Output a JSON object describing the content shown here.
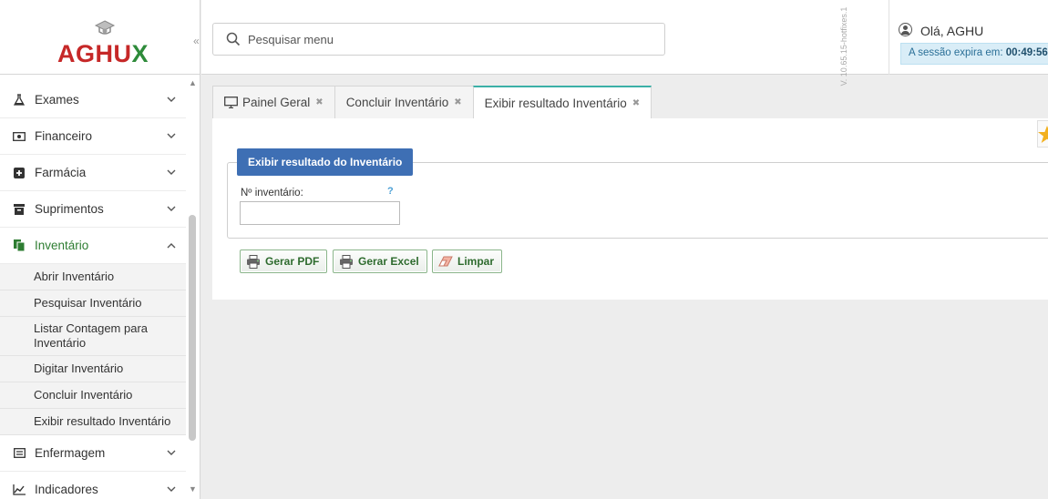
{
  "logo": {
    "text_main": "AGHU",
    "text_x": "X"
  },
  "sidebar": {
    "collapse_glyph": "«",
    "items": [
      {
        "label": "Exames",
        "icon": "flask-icon"
      },
      {
        "label": "Financeiro",
        "icon": "money-icon"
      },
      {
        "label": "Farmácia",
        "icon": "plus-square-icon"
      },
      {
        "label": "Suprimentos",
        "icon": "archive-icon"
      },
      {
        "label": "Inventário",
        "icon": "copy-icon",
        "expanded": true
      },
      {
        "label": "Enfermagem",
        "icon": "list-alt-icon"
      },
      {
        "label": "Indicadores",
        "icon": "line-chart-icon"
      }
    ],
    "inventario_subitems": [
      "Abrir Inventário",
      "Pesquisar Inventário",
      "Listar Contagem para Inventário",
      "Digitar Inventário",
      "Concluir Inventário",
      "Exibir resultado Inventário"
    ]
  },
  "search": {
    "placeholder": "Pesquisar menu",
    "value": ""
  },
  "version": "V. 10.65.15-hotfixes.1",
  "user": {
    "greeting": "Olá, AGHU",
    "session_label": "A sessão expira em:",
    "session_time": "00:49:56"
  },
  "tabs": [
    {
      "label": "Painel Geral",
      "icon": "monitor-icon",
      "active": false
    },
    {
      "label": "Concluir Inventário",
      "active": false
    },
    {
      "label": "Exibir resultado Inventário",
      "active": true
    }
  ],
  "form": {
    "legend": "Exibir resultado do Inventário",
    "inventory_label": "Nº inventário:",
    "help": "?",
    "inventory_value": ""
  },
  "buttons": {
    "pdf": "Gerar PDF",
    "excel": "Gerar Excel",
    "clear": "Limpar"
  },
  "colors": {
    "brand_red": "#c62828",
    "brand_green": "#2e8b3a",
    "active_menu": "#2e7d32",
    "legend_bg": "#3e6fb4",
    "tab_accent": "#3bb0a7",
    "session_bg": "#d9edf7"
  }
}
